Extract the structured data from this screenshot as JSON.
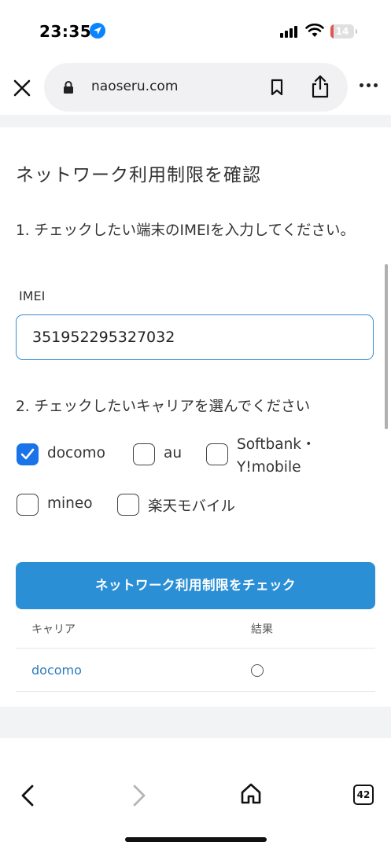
{
  "status_bar": {
    "time": "23:35",
    "battery_level": "14",
    "battery_fraction": 0.14,
    "icons": [
      "location-arrow-icon",
      "cellular-signal-icon",
      "wifi-icon",
      "battery-icon"
    ]
  },
  "browser": {
    "url": "naoseru.com",
    "icons": [
      "close-icon",
      "lock-icon",
      "bookmark-icon",
      "share-icon",
      "more-icon"
    ]
  },
  "page": {
    "heading": "ネットワーク利用制限を確認",
    "step1_text": "1. チェックしたい端末のIMEIを入力してください。",
    "imei_label": "IMEI",
    "imei_value": "351952295327032",
    "step2_text": "2. チェックしたいキャリアを選んでください",
    "carriers": [
      {
        "label": "docomo",
        "checked": true
      },
      {
        "label": "au",
        "checked": false
      },
      {
        "label": "Softbank・Y!mobile",
        "checked": false
      },
      {
        "label": "mineo",
        "checked": false
      },
      {
        "label": "楽天モバイル",
        "checked": false
      }
    ],
    "softbank_line1": "Softbank・",
    "softbank_line2": "Y!mobile",
    "check_button": "ネットワーク利用制限をチェック",
    "table": {
      "headers": [
        "キャリア",
        "結果"
      ],
      "rows": [
        {
          "carrier": "docomo",
          "result": "○"
        }
      ]
    }
  },
  "toolbar": {
    "tab_count": "42",
    "icons": [
      "back-icon",
      "forward-icon",
      "home-icon",
      "tabs-icon"
    ]
  },
  "colors": {
    "accent": "#2b8fd6",
    "checkbox_checked": "#1a73e8",
    "link": "#2b7bbf",
    "battery_low": "#e05555"
  }
}
